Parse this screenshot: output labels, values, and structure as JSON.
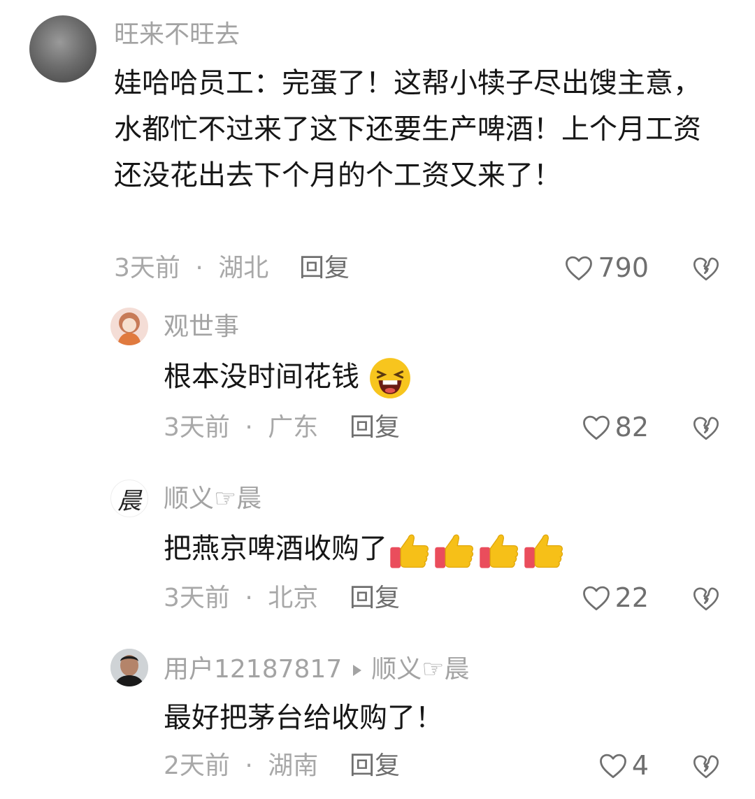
{
  "comments": [
    {
      "username": "旺来不旺去",
      "text": "娃哈哈员工：完蛋了！这帮小犊子尽出馊主意，水都忙不过来了这下还要生产啤酒！上个月工资还没花出去下个月的个工资又来了！",
      "time": "3天前",
      "location": "湖北",
      "reply_label": "回复",
      "likes": "790"
    },
    {
      "username": "观世事",
      "text": "根本没时间花钱",
      "emoji": "laughing-face-emoji",
      "time": "3天前",
      "location": "广东",
      "reply_label": "回复",
      "likes": "82"
    },
    {
      "username": "顺义☞晨",
      "avatar_glyph": "晨",
      "text": "把燕京啤酒收购了",
      "emoji": "thumbs-up-emoji",
      "emoji_count": 4,
      "time": "3天前",
      "location": "北京",
      "reply_label": "回复",
      "likes": "22"
    },
    {
      "username": "用户12187817",
      "reply_to": "顺义☞晨",
      "text": "最好把茅台给收购了！",
      "time": "2天前",
      "location": "湖南",
      "reply_label": "回复",
      "likes": "4"
    }
  ],
  "separator": "·",
  "icons": {
    "like": "heart-outline-icon",
    "dislike": "broken-heart-icon"
  },
  "colors": {
    "username": "#a3a3a3",
    "text": "#161616",
    "meta": "#a8a8a8",
    "action": "#6f6f6f"
  }
}
